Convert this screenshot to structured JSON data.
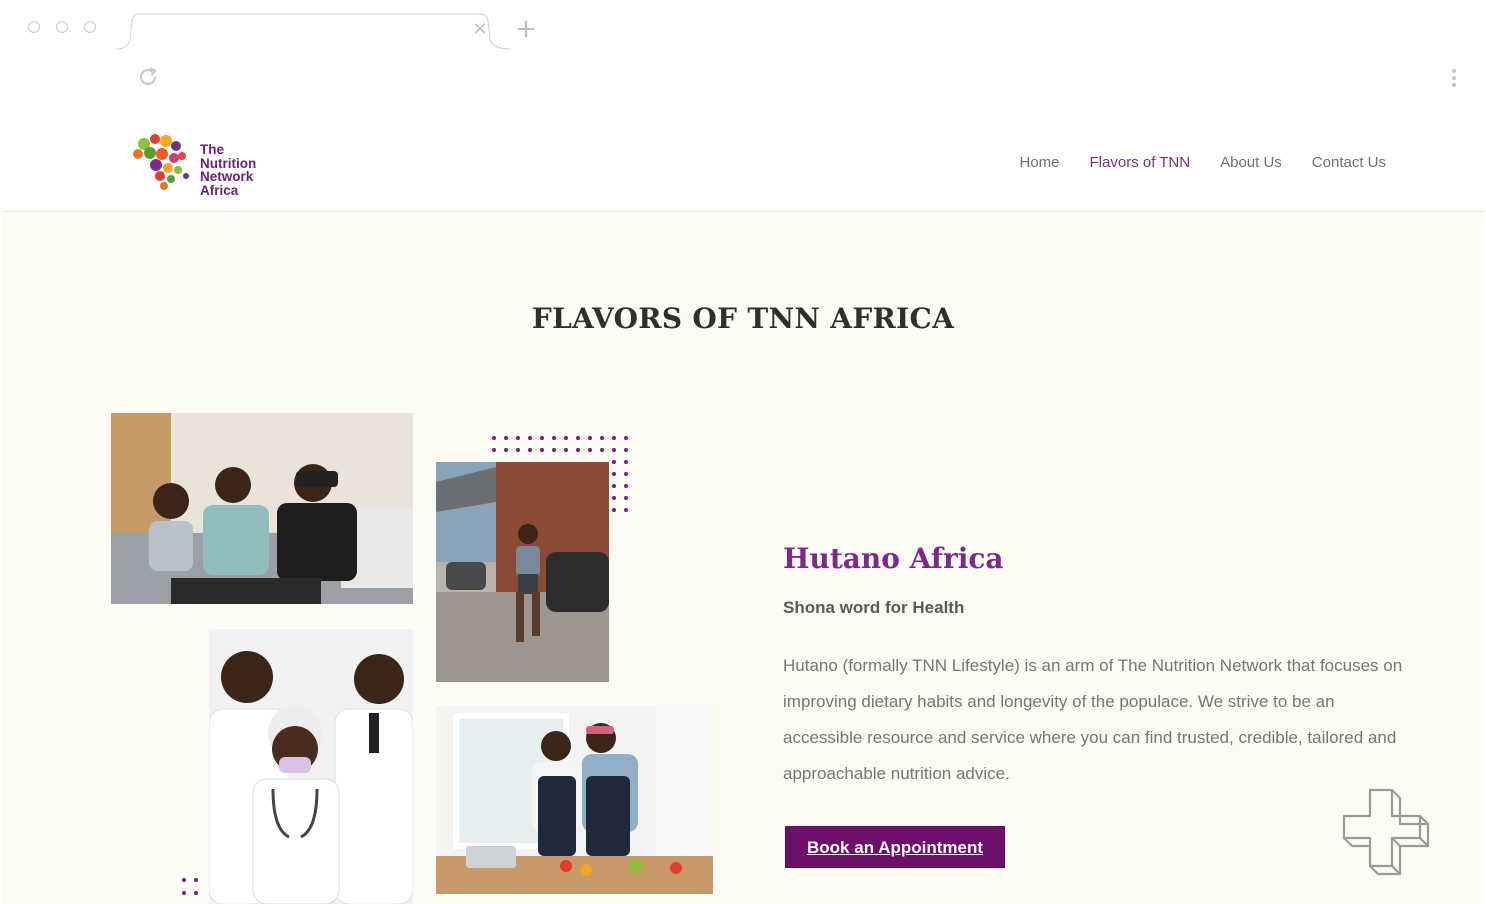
{
  "browser": {
    "tab_close_glyph": "×",
    "new_tab_glyph": "+",
    "icons": [
      "reload-icon",
      "kebab-menu-icon",
      "tab-close-icon",
      "new-tab-icon"
    ]
  },
  "header": {
    "logo_lines": [
      "The",
      "Nutrition",
      "Network",
      "Africa"
    ],
    "nav": [
      {
        "label": "Home",
        "active": false
      },
      {
        "label": "Flavors of TNN",
        "active": true
      },
      {
        "label": "About Us",
        "active": false
      },
      {
        "label": "Contact Us",
        "active": false
      }
    ]
  },
  "main": {
    "section_title": "FLAVORS OF TNN AFRICA",
    "headline": "Hutano Africa",
    "subhead": "Shona word for Health",
    "body": "Hutano (formally TNN Lifestyle) is an arm of The Nutrition Network that focuses on improving dietary habits and longevity of the populace. We strive to be an accessible resource and service where you can find trusted, credible, tailored and approachable nutrition advice.",
    "cta_label": "Book an Appointment",
    "decorative_icon": "medical-cross-icon"
  },
  "colors": {
    "brand_purple": "#7b2a8a",
    "button_purple": "#6e0f6b",
    "section_bg": "#fdfcf4",
    "heading_dark": "#2f2f2f",
    "body_grey": "#757575"
  }
}
